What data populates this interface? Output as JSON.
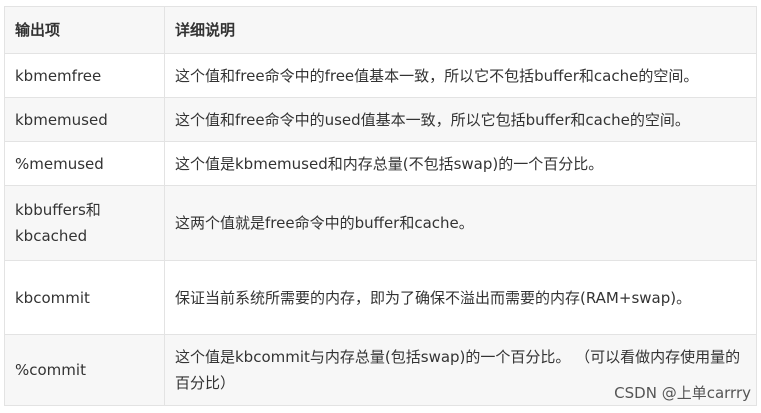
{
  "table": {
    "headers": [
      "输出项",
      "详细说明"
    ],
    "rows": [
      {
        "name": "kbmemfree",
        "desc": "这个值和free命令中的free值基本一致，所以它不包括buffer和cache的空间。"
      },
      {
        "name": "kbmemused",
        "desc": "这个值和free命令中的used值基本一致，所以它包括buffer和cache的空间。"
      },
      {
        "name": "%memused",
        "desc": "这个值是kbmemused和内存总量(不包括swap)的一个百分比。"
      },
      {
        "name": "kbbuffers和kbcached",
        "desc": "这两个值就是free命令中的buffer和cache。"
      },
      {
        "name": "kbcommit",
        "desc": "保证当前系统所需要的内存，即为了确保不溢出而需要的内存(RAM+swap)。"
      },
      {
        "name": "%commit",
        "desc": "这个值是kbcommit与内存总量(包括swap)的一个百分比。 （可以看做内存使用量的百分比）"
      }
    ]
  },
  "watermark": "CSDN @上单carrry"
}
